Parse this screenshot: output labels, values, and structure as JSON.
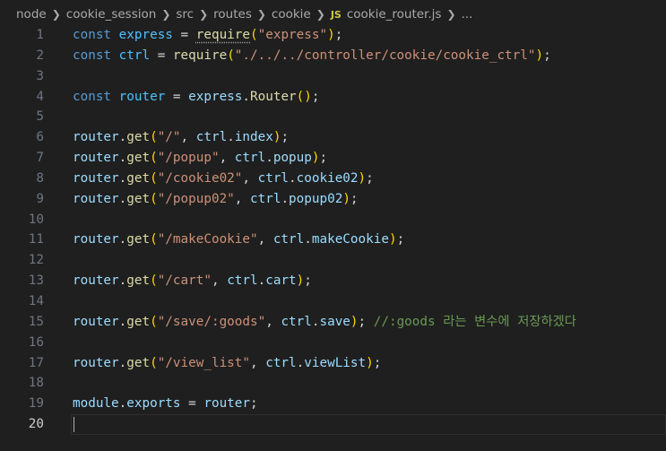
{
  "breadcrumb": {
    "items": [
      "node",
      "cookie_session",
      "src",
      "routes",
      "cookie"
    ],
    "file_icon": "JS",
    "file": "cookie_router.js",
    "more": "..."
  },
  "colors": {
    "keyword": "#569cd6",
    "constant": "#4fc1ff",
    "variable": "#9cdcfe",
    "function": "#dcdcaa",
    "string": "#ce9178",
    "comment": "#6a9955",
    "bracket1": "#ffd700",
    "bracket2": "#da70d6",
    "background": "#1f1f1f"
  },
  "editor": {
    "active_line": 20,
    "lines": [
      {
        "n": "1",
        "tokens": [
          [
            "kw",
            "const "
          ],
          [
            "var",
            "express"
          ],
          [
            "punc",
            " = "
          ],
          [
            "fn",
            "require"
          ],
          [
            "p1",
            "("
          ],
          [
            "str",
            "\"express\""
          ],
          [
            "p1",
            ")"
          ],
          [
            "punc",
            ";"
          ]
        ]
      },
      {
        "n": "2",
        "tokens": [
          [
            "kw",
            "const "
          ],
          [
            "var",
            "ctrl"
          ],
          [
            "punc",
            " = "
          ],
          [
            "fn",
            "require"
          ],
          [
            "p1",
            "("
          ],
          [
            "str",
            "\"./../../controller/cookie/cookie_ctrl\""
          ],
          [
            "p1",
            ")"
          ],
          [
            "punc",
            ";"
          ]
        ]
      },
      {
        "n": "3",
        "tokens": []
      },
      {
        "n": "4",
        "tokens": [
          [
            "kw",
            "const "
          ],
          [
            "var",
            "router"
          ],
          [
            "punc",
            " = "
          ],
          [
            "mod",
            "express"
          ],
          [
            "punc",
            "."
          ],
          [
            "fn",
            "Router"
          ],
          [
            "p1",
            "()"
          ],
          [
            "punc",
            ";"
          ]
        ]
      },
      {
        "n": "5",
        "tokens": []
      },
      {
        "n": "6",
        "tokens": [
          [
            "mod",
            "router"
          ],
          [
            "punc",
            "."
          ],
          [
            "fn",
            "get"
          ],
          [
            "p1",
            "("
          ],
          [
            "str",
            "\"/\""
          ],
          [
            "punc",
            ", "
          ],
          [
            "mod",
            "ctrl"
          ],
          [
            "punc",
            "."
          ],
          [
            "prop",
            "index"
          ],
          [
            "p1",
            ")"
          ],
          [
            "punc",
            ";"
          ]
        ]
      },
      {
        "n": "7",
        "tokens": [
          [
            "mod",
            "router"
          ],
          [
            "punc",
            "."
          ],
          [
            "fn",
            "get"
          ],
          [
            "p1",
            "("
          ],
          [
            "str",
            "\"/popup\""
          ],
          [
            "punc",
            ", "
          ],
          [
            "mod",
            "ctrl"
          ],
          [
            "punc",
            "."
          ],
          [
            "prop",
            "popup"
          ],
          [
            "p1",
            ")"
          ],
          [
            "punc",
            ";"
          ]
        ]
      },
      {
        "n": "8",
        "tokens": [
          [
            "mod",
            "router"
          ],
          [
            "punc",
            "."
          ],
          [
            "fn",
            "get"
          ],
          [
            "p1",
            "("
          ],
          [
            "str",
            "\"/cookie02\""
          ],
          [
            "punc",
            ", "
          ],
          [
            "mod",
            "ctrl"
          ],
          [
            "punc",
            "."
          ],
          [
            "prop",
            "cookie02"
          ],
          [
            "p1",
            ")"
          ],
          [
            "punc",
            ";"
          ]
        ]
      },
      {
        "n": "9",
        "tokens": [
          [
            "mod",
            "router"
          ],
          [
            "punc",
            "."
          ],
          [
            "fn",
            "get"
          ],
          [
            "p1",
            "("
          ],
          [
            "str",
            "\"/popup02\""
          ],
          [
            "punc",
            ", "
          ],
          [
            "mod",
            "ctrl"
          ],
          [
            "punc",
            "."
          ],
          [
            "prop",
            "popup02"
          ],
          [
            "p1",
            ")"
          ],
          [
            "punc",
            ";"
          ]
        ]
      },
      {
        "n": "10",
        "tokens": []
      },
      {
        "n": "11",
        "tokens": [
          [
            "mod",
            "router"
          ],
          [
            "punc",
            "."
          ],
          [
            "fn",
            "get"
          ],
          [
            "p1",
            "("
          ],
          [
            "str",
            "\"/makeCookie\""
          ],
          [
            "punc",
            ", "
          ],
          [
            "mod",
            "ctrl"
          ],
          [
            "punc",
            "."
          ],
          [
            "prop",
            "makeCookie"
          ],
          [
            "p1",
            ")"
          ],
          [
            "punc",
            ";"
          ]
        ]
      },
      {
        "n": "12",
        "tokens": []
      },
      {
        "n": "13",
        "tokens": [
          [
            "mod",
            "router"
          ],
          [
            "punc",
            "."
          ],
          [
            "fn",
            "get"
          ],
          [
            "p1",
            "("
          ],
          [
            "str",
            "\"/cart\""
          ],
          [
            "punc",
            ", "
          ],
          [
            "mod",
            "ctrl"
          ],
          [
            "punc",
            "."
          ],
          [
            "prop",
            "cart"
          ],
          [
            "p1",
            ")"
          ],
          [
            "punc",
            ";"
          ]
        ]
      },
      {
        "n": "14",
        "tokens": []
      },
      {
        "n": "15",
        "tokens": [
          [
            "mod",
            "router"
          ],
          [
            "punc",
            "."
          ],
          [
            "fn",
            "get"
          ],
          [
            "p1",
            "("
          ],
          [
            "str",
            "\"/save/:goods\""
          ],
          [
            "punc",
            ", "
          ],
          [
            "mod",
            "ctrl"
          ],
          [
            "punc",
            "."
          ],
          [
            "prop",
            "save"
          ],
          [
            "p1",
            ")"
          ],
          [
            "punc",
            "; "
          ],
          [
            "cm",
            "//:goods 라는 변수에 저장하겠다"
          ]
        ]
      },
      {
        "n": "16",
        "tokens": []
      },
      {
        "n": "17",
        "tokens": [
          [
            "mod",
            "router"
          ],
          [
            "punc",
            "."
          ],
          [
            "fn",
            "get"
          ],
          [
            "p1",
            "("
          ],
          [
            "str",
            "\"/view_list\""
          ],
          [
            "punc",
            ", "
          ],
          [
            "mod",
            "ctrl"
          ],
          [
            "punc",
            "."
          ],
          [
            "prop",
            "viewList"
          ],
          [
            "p1",
            ")"
          ],
          [
            "punc",
            ";"
          ]
        ]
      },
      {
        "n": "18",
        "tokens": []
      },
      {
        "n": "19",
        "tokens": [
          [
            "mod",
            "module"
          ],
          [
            "punc",
            "."
          ],
          [
            "mod",
            "exports"
          ],
          [
            "punc",
            " = "
          ],
          [
            "mod",
            "router"
          ],
          [
            "punc",
            ";"
          ]
        ]
      },
      {
        "n": "20",
        "tokens": []
      }
    ]
  }
}
